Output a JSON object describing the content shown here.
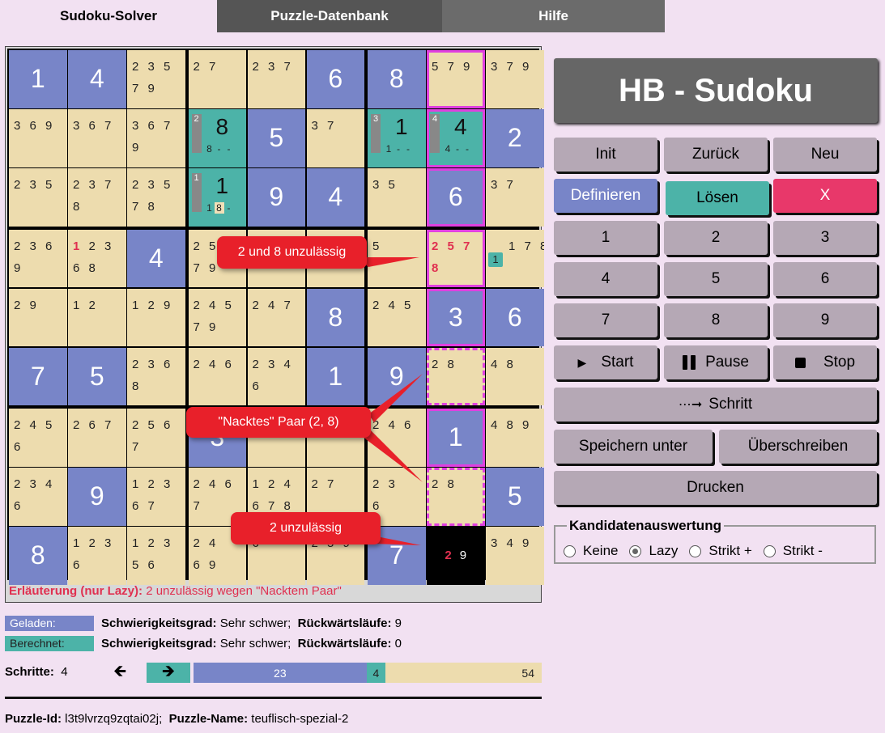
{
  "tabs": [
    "Sudoku-Solver",
    "Puzzle-Datenbank",
    "Hilfe"
  ],
  "app_title": "HB - Sudoku",
  "buttons": {
    "init": "Init",
    "zurueck": "Zurück",
    "neu": "Neu",
    "definieren": "Definieren",
    "loesen": "Lösen",
    "x": "X",
    "digits": [
      "1",
      "2",
      "3",
      "4",
      "5",
      "6",
      "7",
      "8",
      "9"
    ],
    "start": "Start",
    "pause": "Pause",
    "stop": "Stop",
    "schritt": "Schritt",
    "speichern": "Speichern unter",
    "ueberschreiben": "Überschreiben",
    "drucken": "Drucken"
  },
  "kandidaten": {
    "legend": "Kandidatenauswertung",
    "options": [
      "Keine",
      "Lazy",
      "Strikt +",
      "Strikt -"
    ],
    "selected": "Lazy"
  },
  "grid": [
    [
      {
        "v": "1"
      },
      {
        "v": "4"
      },
      {
        "c": [
          "2 3 5",
          "7 9"
        ]
      },
      {
        "c": [
          "2 7"
        ]
      },
      {
        "c": [
          "2 3 7"
        ]
      },
      {
        "v": "6"
      },
      {
        "v": "8"
      },
      {
        "c": [
          "5 7 9"
        ],
        "hl": "magenta"
      },
      {
        "c": [
          "3 7 9"
        ]
      }
    ],
    [
      {
        "c": [
          "3 6 9"
        ]
      },
      {
        "c": [
          "3 6 7"
        ]
      },
      {
        "c": [
          "3 6 7",
          "9"
        ]
      },
      {
        "s": "8",
        "k": "2",
        "sub": [
          "8",
          "-",
          "-"
        ]
      },
      {
        "v": "5"
      },
      {
        "c": [
          "3 7"
        ]
      },
      {
        "s": "1",
        "k": "3",
        "sub": [
          "1",
          "-",
          "-"
        ]
      },
      {
        "s": "4",
        "k": "4",
        "sub": [
          "4",
          "-",
          "-"
        ],
        "hl": "magenta"
      },
      {
        "v": "2"
      }
    ],
    [
      {
        "c": [
          "2 3 5"
        ]
      },
      {
        "c": [
          "2 3 7",
          "8"
        ]
      },
      {
        "c": [
          "2 3 5",
          "7 8"
        ]
      },
      {
        "s": "1",
        "k": "1",
        "sub": [
          "1",
          "8",
          "-"
        ]
      },
      {
        "v": "9"
      },
      {
        "v": "4"
      },
      {
        "c": [
          "3 5"
        ]
      },
      {
        "v": "6",
        "hl": "magenta"
      },
      {
        "c": [
          "3 7"
        ]
      }
    ],
    [
      {
        "c": [
          "2 3 6",
          "9"
        ]
      },
      {
        "c": [
          "1 2 3",
          "6 8"
        ],
        "redfirst": "1"
      },
      {
        "v": "4"
      },
      {
        "c": [
          "2 5 ",
          "7 9"
        ]
      },
      {
        "c": [
          "",
          ""
        ]
      },
      {
        "c": [
          "",
          "  8"
        ]
      },
      {
        "c": [
          "",
          "  5"
        ]
      },
      {
        "c": [
          "2 5 7",
          "8"
        ],
        "hl": "magenta",
        "red": true
      },
      {
        "c": [
          "1 7 8"
        ],
        "badge": "1"
      }
    ],
    [
      {
        "c": [
          "2 9"
        ]
      },
      {
        "c": [
          "1 2"
        ]
      },
      {
        "c": [
          "1 2 9"
        ]
      },
      {
        "c": [
          "2 4 5",
          "7 9"
        ]
      },
      {
        "c": [
          "2 4 7"
        ]
      },
      {
        "v": "8"
      },
      {
        "c": [
          "2 4 5"
        ]
      },
      {
        "v": "3",
        "hl": "magenta"
      },
      {
        "v": "6"
      }
    ],
    [
      {
        "v": "7"
      },
      {
        "v": "5"
      },
      {
        "c": [
          "2 3 6",
          "8"
        ]
      },
      {
        "c": [
          "2 4 6"
        ]
      },
      {
        "c": [
          "2 3 4",
          "6"
        ]
      },
      {
        "v": "1"
      },
      {
        "v": "9"
      },
      {
        "c": [
          "2 8"
        ],
        "hl": "dashed"
      },
      {
        "c": [
          "4 8"
        ]
      }
    ],
    [
      {
        "c": [
          "2 4 5",
          "6"
        ]
      },
      {
        "c": [
          "2 6 7"
        ]
      },
      {
        "c": [
          "2 5 6",
          "7"
        ]
      },
      {
        "v": "3"
      },
      {
        "c": [
          "",
          "7 8"
        ]
      },
      {
        "c": [
          "",
          "9"
        ]
      },
      {
        "c": [
          "2 4 6"
        ]
      },
      {
        "v": "1",
        "hl": "magenta"
      },
      {
        "c": [
          "4 8 9"
        ]
      }
    ],
    [
      {
        "c": [
          "2 3 4",
          "6"
        ]
      },
      {
        "v": "9"
      },
      {
        "c": [
          "1 2 3",
          "6 7"
        ]
      },
      {
        "c": [
          "2 4 6",
          "7"
        ]
      },
      {
        "c": [
          "1 2 4",
          "6 7 8"
        ]
      },
      {
        "c": [
          "2 7"
        ]
      },
      {
        "c": [
          "2 3",
          "6"
        ]
      },
      {
        "c": [
          "2 8"
        ],
        "hl": "dashed"
      },
      {
        "v": "5"
      }
    ],
    [
      {
        "v": "8"
      },
      {
        "c": [
          "1 2 3",
          "6"
        ]
      },
      {
        "c": [
          "1 2 3",
          "5 6"
        ]
      },
      {
        "c": [
          "2 4",
          "6 9"
        ]
      },
      {
        "c": [
          "",
          "6"
        ]
      },
      {
        "c": [
          "2 5 9"
        ]
      },
      {
        "v": "7"
      },
      {
        "black": [
          "2",
          "9"
        ]
      },
      {
        "c": [
          "3 4 9"
        ]
      }
    ]
  ],
  "callouts": {
    "c1": "2 und 8 unzulässig",
    "c2": "\"Nacktes\" Paar (2, 8)",
    "c3": "2 unzulässig"
  },
  "erlaeuterung": {
    "label": "Erläuterung (nur Lazy):",
    "text": "2 unzulässig wegen \"Nacktem Paar\""
  },
  "geladen": {
    "tag": "Geladen:",
    "grad_label": "Schwierigkeitsgrad:",
    "grad": "Sehr schwer;",
    "rl_label": "Rückwärtsläufe:",
    "rl": "9"
  },
  "berechnet": {
    "tag": "Berechnet:",
    "grad_label": "Schwierigkeitsgrad:",
    "grad": "Sehr schwer;",
    "rl_label": "Rückwärtsläufe:",
    "rl": "0"
  },
  "schritte": {
    "label": "Schritte:",
    "value": "4",
    "given": "23",
    "solved": "4",
    "total": "54"
  },
  "puzzle": {
    "id_label": "Puzzle-Id:",
    "id": "l3t9lvrzq9zqtai02j;",
    "name_label": "Puzzle-Name:",
    "name": "teuflisch-spezial-2"
  },
  "colors": {
    "given": "#7885c8",
    "solved": "#4cb3a8",
    "candidate": "#eddcae",
    "highlight": "#e040e0",
    "callout": "#e8202a"
  }
}
